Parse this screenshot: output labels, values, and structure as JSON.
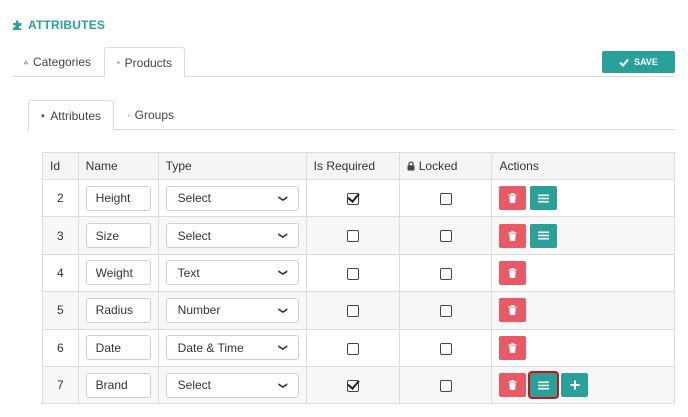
{
  "page": {
    "title": "ATTRIBUTES",
    "title_icon": "puzzle-icon"
  },
  "top_tabs": [
    {
      "label": "Categories",
      "icon": "sitemap-icon",
      "active": false
    },
    {
      "label": "Products",
      "icon": "cube-icon",
      "active": true
    }
  ],
  "toolbar": {
    "save_label": "SAVE",
    "save_icon": "check-icon"
  },
  "sub_tabs": [
    {
      "label": "Attributes",
      "icon": "puzzle-icon",
      "active": true
    },
    {
      "label": "Groups",
      "icon": "cube-icon",
      "active": false
    }
  ],
  "table": {
    "headers": {
      "id": "Id",
      "name": "Name",
      "type": "Type",
      "required": "Is Required",
      "locked": "Locked",
      "actions": "Actions"
    },
    "rows": [
      {
        "id": "2",
        "name": "Height",
        "type": "Select",
        "required": true,
        "locked": false,
        "actions": [
          "delete",
          "options"
        ]
      },
      {
        "id": "3",
        "name": "Size",
        "type": "Select",
        "required": false,
        "locked": false,
        "actions": [
          "delete",
          "options"
        ]
      },
      {
        "id": "4",
        "name": "Weight",
        "type": "Text",
        "required": false,
        "locked": false,
        "actions": [
          "delete"
        ]
      },
      {
        "id": "5",
        "name": "Radius",
        "type": "Number",
        "required": false,
        "locked": false,
        "actions": [
          "delete"
        ]
      },
      {
        "id": "6",
        "name": "Date",
        "type": "Date & Time",
        "required": false,
        "locked": false,
        "actions": [
          "delete"
        ]
      },
      {
        "id": "7",
        "name": "Brand",
        "type": "Select",
        "required": true,
        "locked": false,
        "actions": [
          "delete",
          "options",
          "add"
        ]
      }
    ]
  },
  "colors": {
    "accent": "#2aa198",
    "danger": "#e85a66",
    "focus_outline": "#c0161f"
  }
}
